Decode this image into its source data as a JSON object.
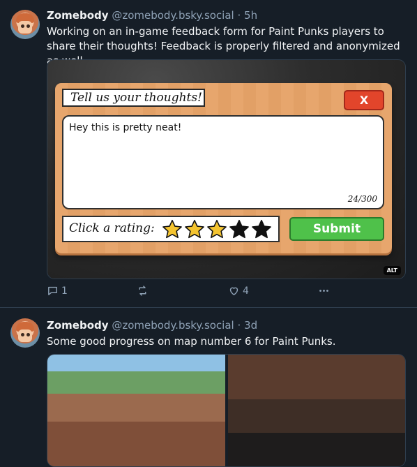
{
  "posts": [
    {
      "author_name": "Zomebody",
      "handle": "@zomebody.bsky.social",
      "time": "· 5h",
      "text": "Working on an in-game feedback form for Paint Punks players to share their thoughts! Feedback is properly filtered and anonymized as well.",
      "media": {
        "form_title": "Tell us your thoughts!",
        "close_label": "X",
        "feedback_text": "Hey this is pretty neat!",
        "counter": "24/300",
        "rating_label": "Click a rating:",
        "rating": 3,
        "rating_max": 5,
        "submit_label": "Submit",
        "alt_badge": "ALT"
      },
      "reply_count": "1",
      "like_count": "4"
    },
    {
      "author_name": "Zomebody",
      "handle": "@zomebody.bsky.social",
      "time": "· 3d",
      "text": "Some good progress on map number 6 for Paint Punks."
    }
  ],
  "colors": {
    "background": "#161e27",
    "muted": "#8fa2b6",
    "submit_green": "#4fc14a",
    "close_red": "#e2452b",
    "star_gold": "#f4c430"
  }
}
